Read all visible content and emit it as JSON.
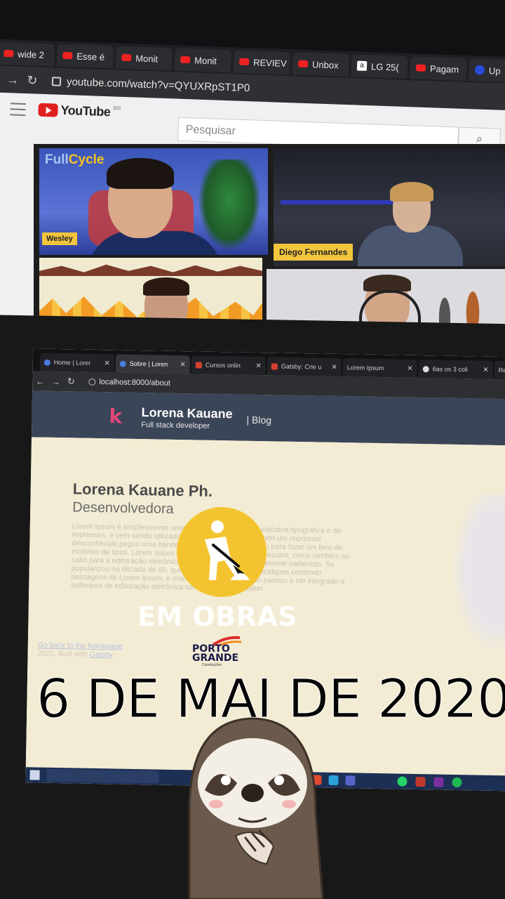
{
  "back_monitor": {
    "tabs": [
      {
        "label": "wide 2",
        "icon": "youtube-icon"
      },
      {
        "label": "Esse é",
        "icon": "youtube-icon"
      },
      {
        "label": "Monit",
        "icon": "youtube-icon"
      },
      {
        "label": "Monit",
        "icon": "youtube-icon"
      },
      {
        "label": "REVIEV",
        "icon": "youtube-icon"
      },
      {
        "label": "Unbox",
        "icon": "youtube-icon"
      },
      {
        "label": "LG 25(",
        "icon": "amazon-icon"
      },
      {
        "label": "Pagam",
        "icon": "youtube-icon"
      },
      {
        "label": "Up",
        "icon": "globe-icon"
      }
    ],
    "url": "youtube.com/watch?v=QYUXRpST1P0",
    "youtube": {
      "logo_text": "YouTube",
      "logo_sup": "BR",
      "search_placeholder": "Pesquisar"
    },
    "video": {
      "brand_part1": "Full",
      "brand_part2": "Cycle",
      "participants": [
        "Wesley",
        "Diego Fernandes"
      ]
    }
  },
  "laptop": {
    "tabs": [
      {
        "label": "Home | Lorer",
        "active": false
      },
      {
        "label": "Sobre | Loren",
        "active": true
      },
      {
        "label": "Cursos onlin",
        "active": false
      },
      {
        "label": "Gatsby: Crie u",
        "active": false
      },
      {
        "label": "Lorem Ipsum",
        "active": false
      },
      {
        "label": "6as os 3 coli",
        "active": false
      },
      {
        "label": "Re",
        "active": false
      }
    ],
    "url": "localhost:8000/about",
    "blog": {
      "logo_letter": "k",
      "brand_name": "Lorena Kauane",
      "brand_sub": "Full stack developer",
      "nav_blog": "| Blog"
    },
    "content": {
      "name": "Lorena Kauane Ph.",
      "role": "Desenvolvedora",
      "lorem": "Lorem Ipsum é simplesmente uma simulação de texto da indústria tipográfica e de impressos, e vem sendo utilizado desde o século XVI, quando um impressor desconhecido pegou uma bandeja de tipos e os embaralhou para fazer um livro de modelos de tipos. Lorem Ipsum sobreviveu não só a cinco séculos, como também ao salto para a editoração eletrônica, permanecendo essencialmente inalterado. Se popularizou na década de 60, quando a Letraset lançou decalques contendo passagens de Lorem Ipsum, e mais recentemente quando passou a ser integrado a softwares de editoração eletrônica como Aldus PageMaker",
      "back_link": "Go back to the homepage",
      "footer_prefix": "2020, Built with ",
      "footer_link": "Gatsby"
    }
  },
  "stickers": {
    "obras_icon": "construction-worker-icon",
    "obras_text": "EM OBRAS",
    "porto_text_1": "PORTO",
    "porto_text_2": "GRANDE",
    "porto_sub": "Construções",
    "date": "6 DE MAI DE 2020",
    "sloth": "sloth-sticker"
  },
  "colors": {
    "obras_yellow": "#f4c430",
    "youtube_red": "#e02020",
    "blog_header": "#3b4558",
    "logo_pink": "#e2477a",
    "fc_yellow": "#f6c21f"
  }
}
